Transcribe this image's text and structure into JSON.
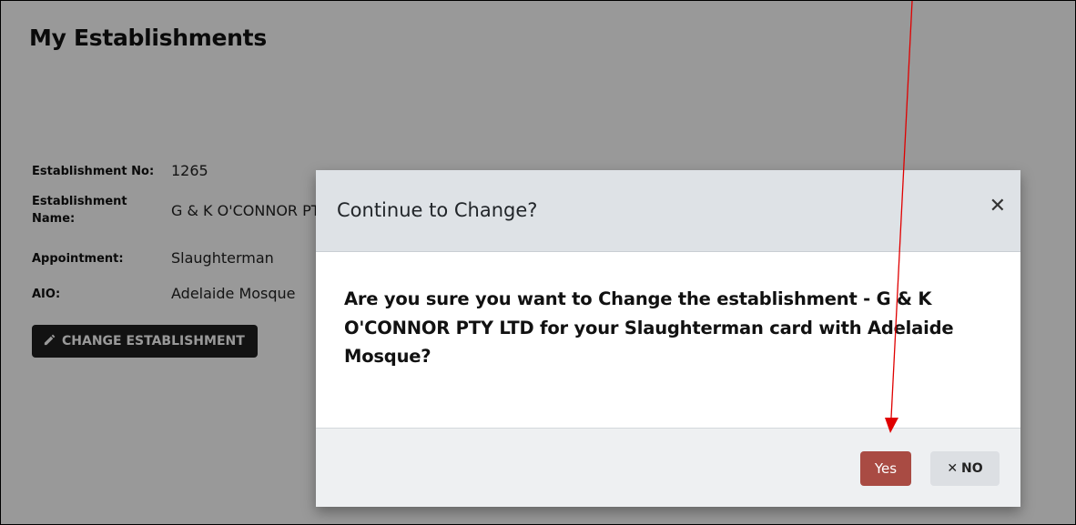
{
  "page": {
    "title": "My Establishments"
  },
  "details": {
    "establishment_no_label": "Establishment No:",
    "establishment_no_value": "1265",
    "establishment_name_label": "Establishment Name:",
    "establishment_name_value": "G & K O'CONNOR PTY LTD",
    "appointment_label": "Appointment:",
    "appointment_value": "Slaughterman",
    "aio_label": "AIO:",
    "aio_value": "Adelaide Mosque"
  },
  "actions": {
    "change_establishment_label": "CHANGE ESTABLISHMENT"
  },
  "modal": {
    "title": "Continue to Change?",
    "body": "Are you sure you want to Change the establishment - G & K O'CONNOR PTY LTD for your Slaughterman card with Adelaide Mosque?",
    "yes_label": "Yes",
    "no_label": "NO"
  },
  "icons": {
    "edit": "pencil-icon",
    "close": "close-icon",
    "no": "x-icon"
  },
  "colors": {
    "change_button_bg": "#1f1f1f",
    "yes_button_bg": "#a94b43",
    "no_button_bg": "#dcdfe3",
    "annotation_arrow": "#e00000"
  }
}
